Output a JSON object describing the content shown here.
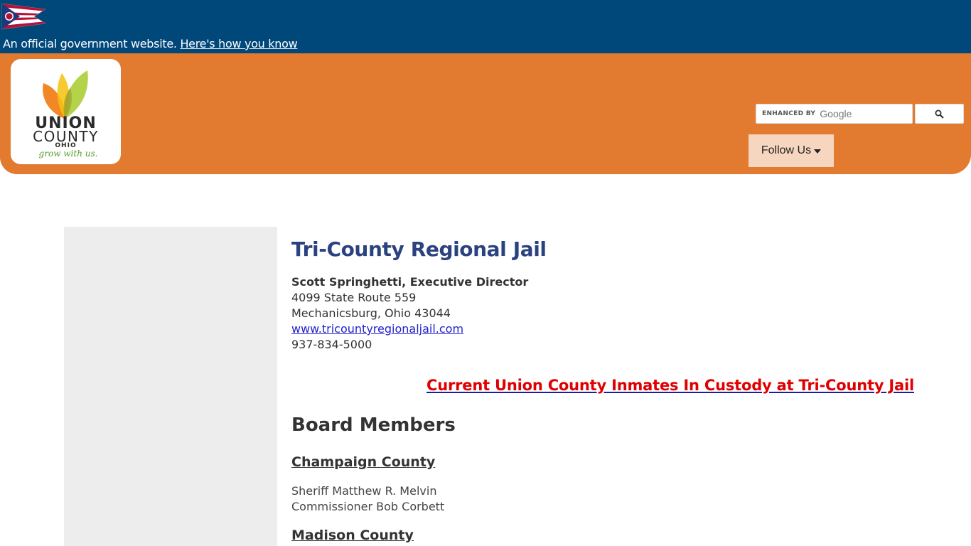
{
  "gov_banner": {
    "text": "An official government website.",
    "link_label": "Here's how you know",
    "flag_icon": "ohio-flag-icon",
    "background": "#00477a"
  },
  "header": {
    "background": "#e27a2f",
    "logo": {
      "line1": "UNION",
      "line2": "COUNTY",
      "line3": "OHIO",
      "tagline": "grow with us."
    },
    "search": {
      "placeholder_prefix": "ENHANCED BY",
      "placeholder_brand": "Google",
      "button_icon": "search-icon"
    },
    "follow_us_label": "Follow Us"
  },
  "main": {
    "title": "Tri-County Regional Jail",
    "director": "Scott Springhetti, Executive Director",
    "address_line1": "4099 State Route 559",
    "address_line2": "Mechanicsburg, Ohio 43044",
    "website": "www.tricountyregionaljail.com ",
    "phone": "937-834-5000",
    "inmates_link": "Current Union County Inmates In Custody at Tri-County Jail ",
    "board_title": "Board Members",
    "counties": [
      {
        "name": "Champaign County ",
        "members": [
          "Sheriff Matthew R. Melvin",
          "Commissioner Bob Corbett"
        ]
      },
      {
        "name": "Madison County ",
        "members": []
      }
    ]
  }
}
